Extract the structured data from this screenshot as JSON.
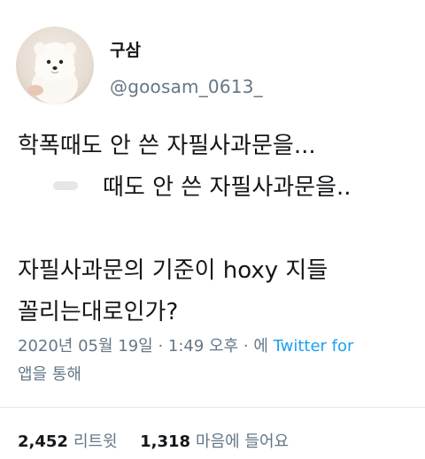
{
  "user": {
    "display_name": "구삼",
    "handle": "@goosam_0613_"
  },
  "tweet": {
    "line1": "학폭때도 안 쓴 자필사과문을...",
    "line2": "때도 안 쓴 자필사과문을..",
    "line3": "자필사과문의 기준이 hoxy 지들",
    "line4": "꼴리는대로인가?"
  },
  "meta": {
    "timestamp": "2020년 05월 19일 · 1:49 오후 · 에 ",
    "source_link": "Twitter for",
    "source_suffix": "앱을 통해"
  },
  "stats": {
    "retweets_count": "2,452",
    "retweets_label": "리트윗",
    "likes_count": "1,318",
    "likes_label": "마음에 들어요"
  },
  "colors": {
    "text": "#14171a",
    "secondary": "#657786",
    "link": "#1da1f2"
  },
  "icons": {
    "avatar": "white-pomeranian-dog-avatar"
  }
}
